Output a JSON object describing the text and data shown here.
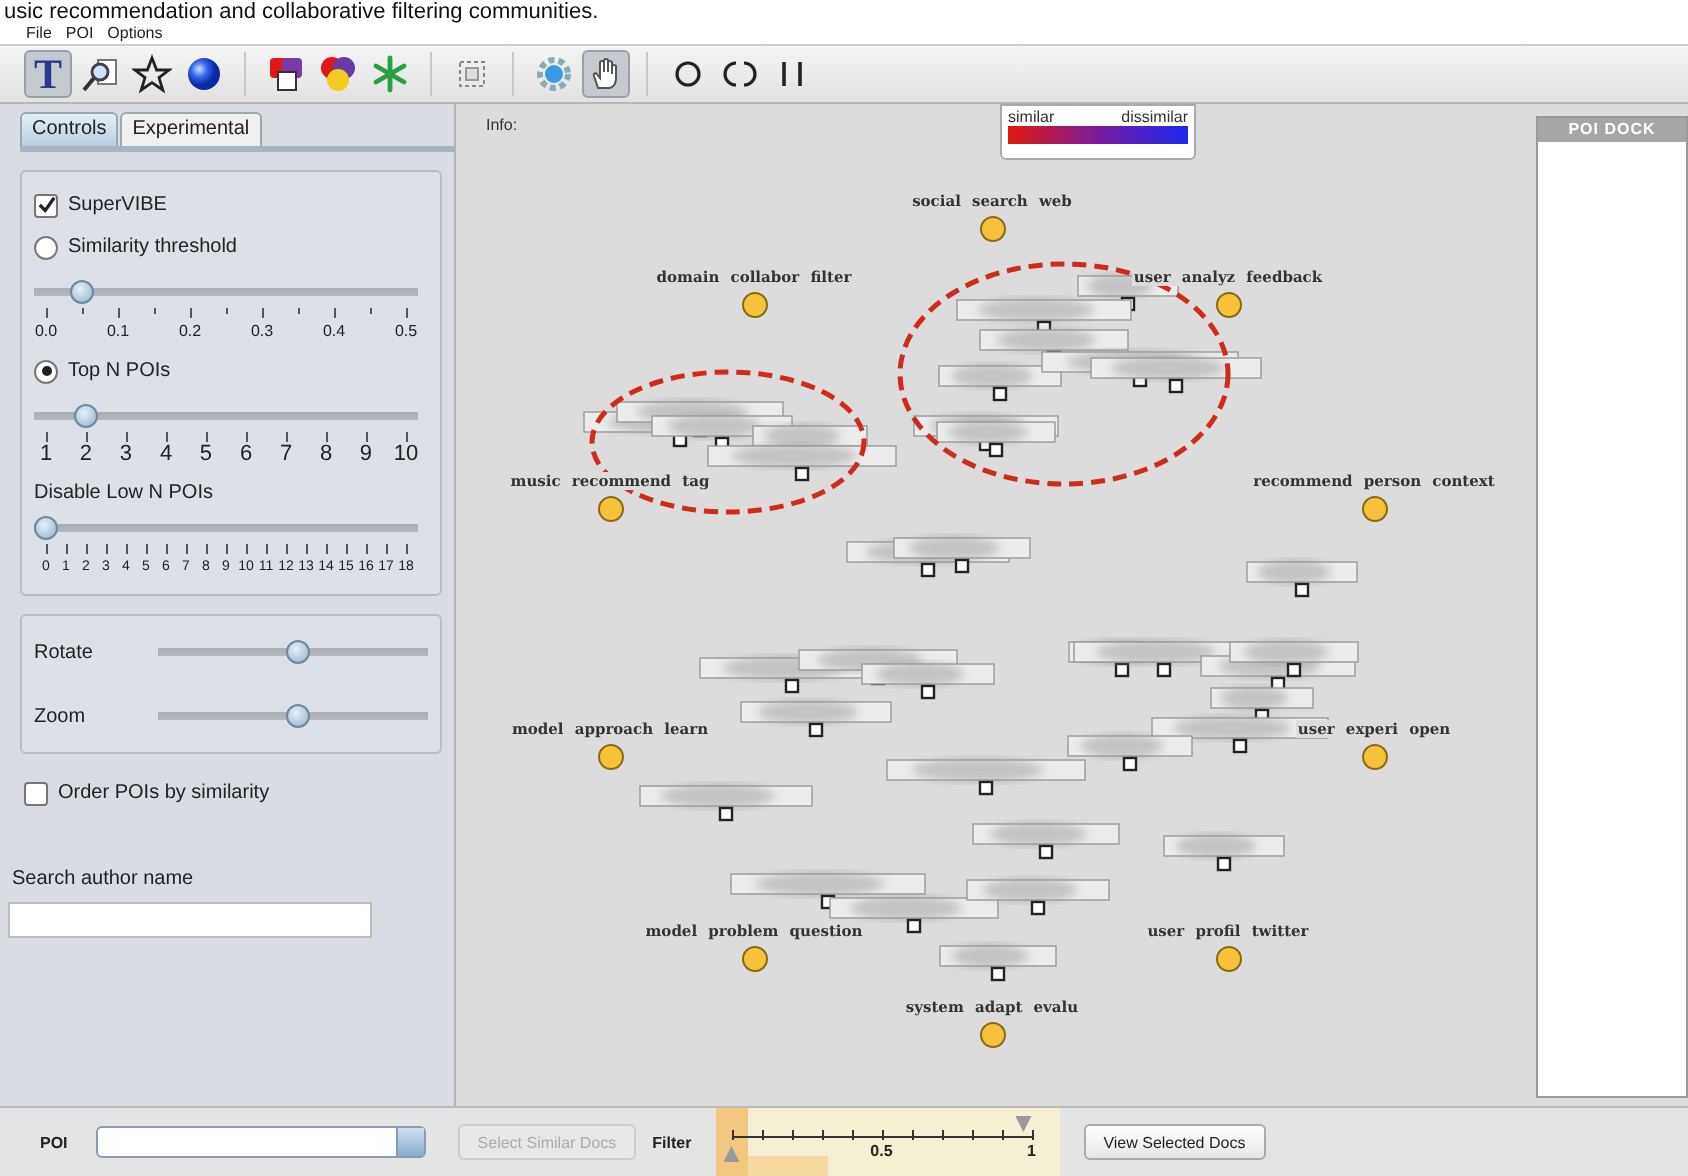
{
  "caption": "usic recommendation and collaborative filtering communities.",
  "menu": [
    "File",
    "POI",
    "Options"
  ],
  "toolbar": [
    {
      "kind": "text",
      "label": "T",
      "selected": true
    },
    {
      "kind": "magnifier",
      "selected": false
    },
    {
      "kind": "star",
      "selected": false
    },
    {
      "kind": "sphere",
      "selected": false
    },
    {
      "kind": "squares-white",
      "selected": false
    },
    {
      "kind": "squares-yellow",
      "selected": false
    },
    {
      "kind": "asterisk",
      "selected": false
    },
    {
      "kind": "select",
      "selected": false
    },
    {
      "kind": "gear",
      "selected": false
    },
    {
      "kind": "hand",
      "selected": true
    },
    {
      "kind": "ring",
      "selected": false
    },
    {
      "kind": "brackets",
      "selected": false
    },
    {
      "kind": "bars",
      "selected": false
    }
  ],
  "tabs": [
    {
      "label": "Controls",
      "selected": true
    },
    {
      "label": "Experimental",
      "selected": false
    }
  ],
  "controls": {
    "supervibe": {
      "label": "SuperVIBE",
      "checked": true
    },
    "modes": [
      {
        "label": "Similarity threshold",
        "selected": false,
        "slider": {
          "level": 0.1,
          "labels": [
            "0.0",
            "0.1",
            "0.2",
            "0.3",
            "0.4",
            "0.5"
          ]
        }
      },
      {
        "label": "Top N POIs",
        "selected": true,
        "slider": {
          "level": 0.111,
          "labels": [
            "1",
            "2",
            "3",
            "4",
            "5",
            "6",
            "7",
            "8",
            "9",
            "10"
          ]
        }
      }
    ],
    "disable_low": {
      "label": "Disable Low N POIs",
      "slider": {
        "level": 0,
        "labels": [
          "0",
          "1",
          "2",
          "3",
          "4",
          "5",
          "6",
          "7",
          "8",
          "9",
          "10",
          "11",
          "12",
          "13",
          "14",
          "15",
          "16",
          "17",
          "18"
        ]
      }
    },
    "view": [
      {
        "label": "Rotate",
        "level": 0.52
      },
      {
        "label": "Zoom",
        "level": 0.52
      }
    ],
    "order": {
      "label": "Order POIs by similarity",
      "checked": false
    },
    "search": {
      "label": "Search author name"
    }
  },
  "canvas": {
    "info": "Info:",
    "legend": {
      "similar": "similar",
      "dissimilar": "dissimilar"
    },
    "pois": [
      {
        "label": "social search web"
      },
      {
        "label": "domain collabor filter"
      },
      {
        "label": "user analyz feedback"
      },
      {
        "label": "music recommend tag"
      },
      {
        "label": "recommend person context"
      },
      {
        "label": "model approach learn"
      },
      {
        "label": "user experi open"
      },
      {
        "label": "model problem question"
      },
      {
        "label": "user profil twitter"
      },
      {
        "label": "system adapt evalu"
      }
    ]
  },
  "dock": {
    "title": "POI DOCK"
  },
  "bottom": {
    "poi_label": "POI",
    "select_button": {
      "label": "Select Similar Docs",
      "disabled": true
    },
    "filter_label": "Filter",
    "filter": {
      "labels": [
        "0.5",
        "1"
      ],
      "level": 1
    },
    "view_button": "View Selected Docs"
  }
}
